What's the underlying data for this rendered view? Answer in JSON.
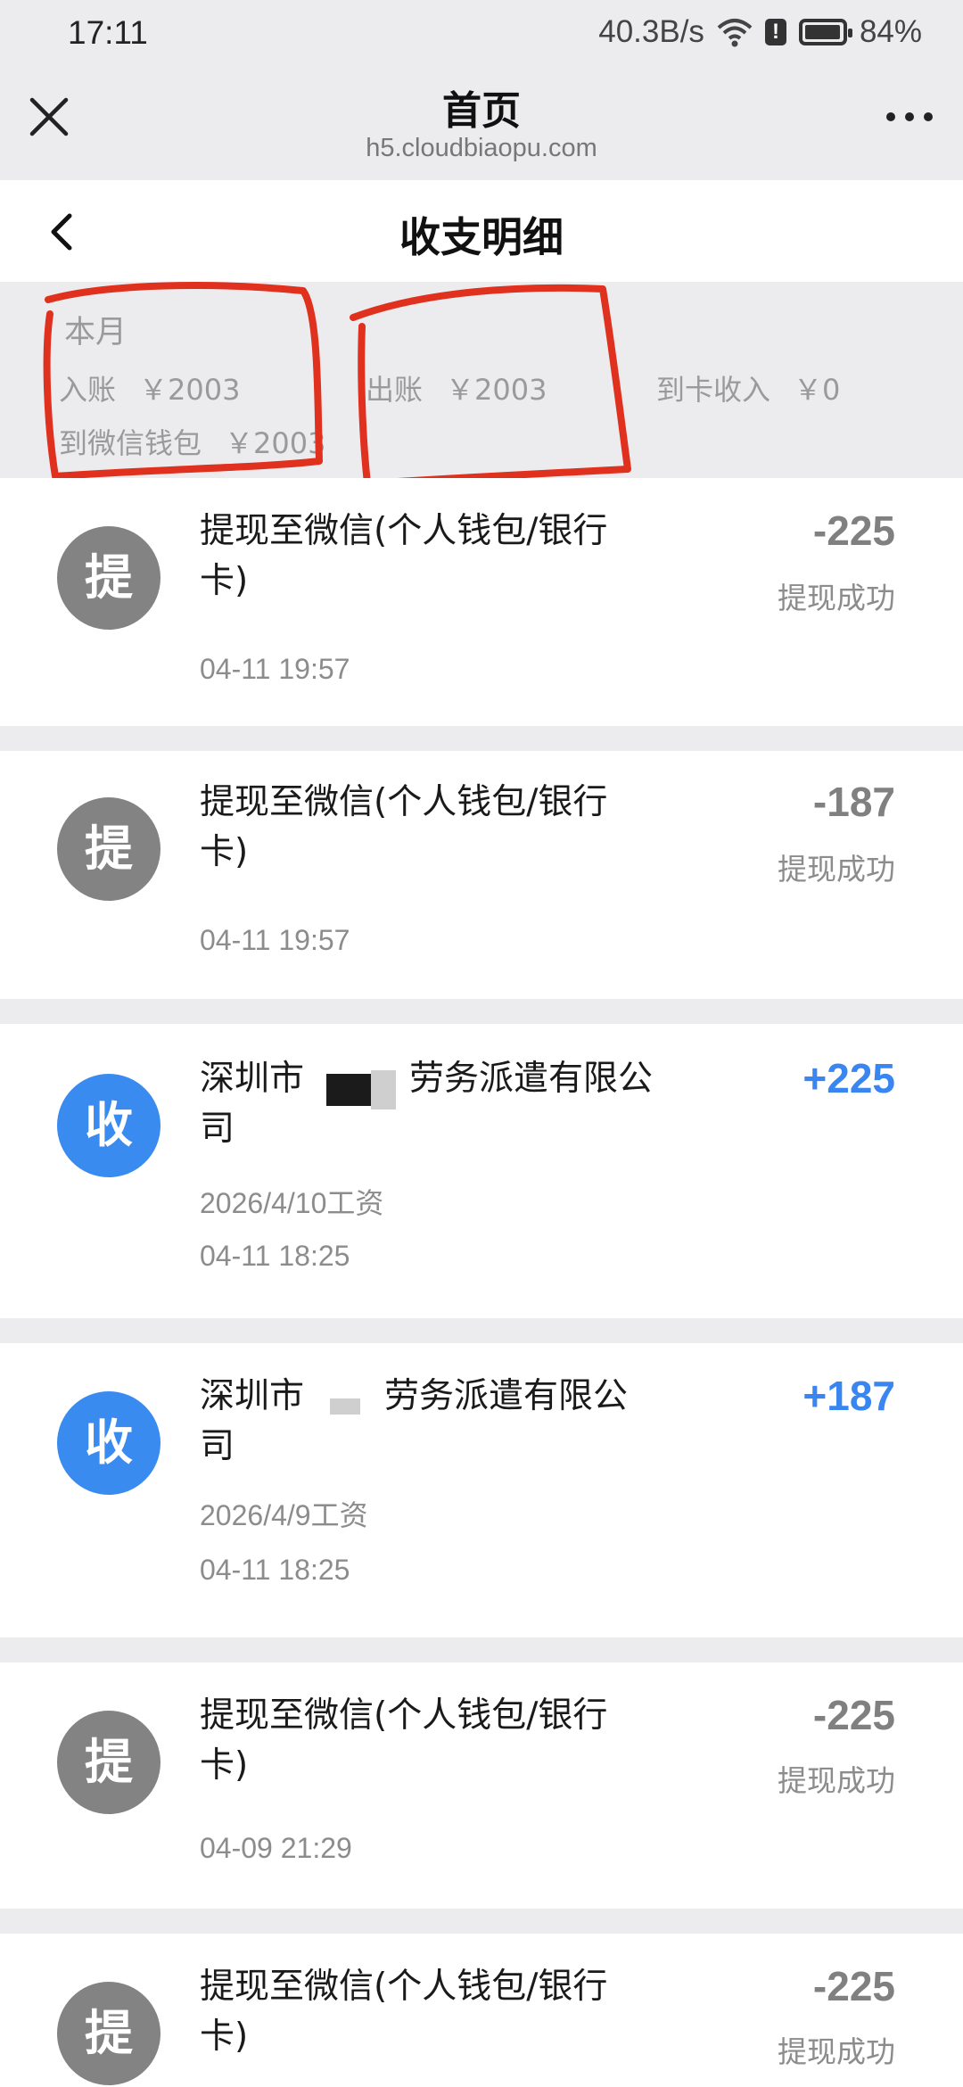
{
  "status_bar": {
    "time": "17:11",
    "net_speed": "40.3B/s",
    "battery": "84%",
    "alert": "!"
  },
  "browser": {
    "title": "首页",
    "domain": "h5.cloudbiaopu.com"
  },
  "header": {
    "title": "收支明细"
  },
  "summary": {
    "period": "本月",
    "income_label": "入账",
    "income_value": "￥2003",
    "expense_label": "出账",
    "expense_value": "￥2003",
    "card_income_label": "到卡收入",
    "card_income_value": "￥0",
    "wechat_label": "到微信钱包",
    "wechat_value": "￥2003"
  },
  "transactions": [
    {
      "icon_char": "提",
      "title_line1": "提现至微信(个人钱包/银行",
      "title_line2": "卡)",
      "time": "04-11 19:57",
      "amount": "-225",
      "status": "提现成功"
    },
    {
      "icon_char": "提",
      "title_line1": "提现至微信(个人钱包/银行",
      "title_line2": "卡)",
      "time": "04-11 19:57",
      "amount": "-187",
      "status": "提现成功"
    },
    {
      "icon_char": "收",
      "title_line1": "深圳市",
      "title_line1_end": "劳务派遣有限公",
      "title_line2": "司",
      "note": "2026/4/10工资",
      "time": "04-11 18:25",
      "amount": "+225"
    },
    {
      "icon_char": "收",
      "title_line1": "深圳市",
      "title_line1_end": "劳务派遣有限公",
      "title_line2": "司",
      "note": "2026/4/9工资",
      "time": "04-11 18:25",
      "amount": "+187"
    },
    {
      "icon_char": "提",
      "title_line1": "提现至微信(个人钱包/银行",
      "title_line2": "卡)",
      "time": "04-09 21:29",
      "amount": "-225",
      "status": "提现成功"
    },
    {
      "icon_char": "提",
      "title_line1": "提现至微信(个人钱包/银行",
      "title_line2": "卡)",
      "amount": "-225",
      "status": "提现成功"
    }
  ]
}
